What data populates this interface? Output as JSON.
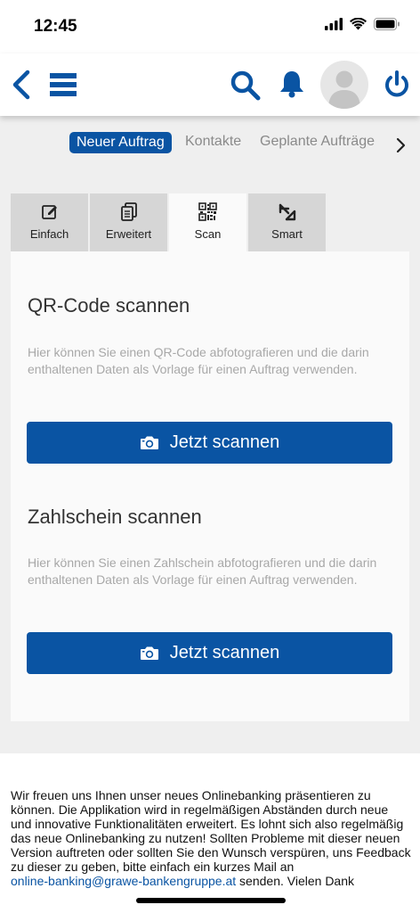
{
  "status_bar": {
    "time": "12:45"
  },
  "header": {
    "icons": [
      "back-icon",
      "menu-icon",
      "search-icon",
      "bell-icon",
      "avatar",
      "power-icon"
    ],
    "accent_color": "#0a54a3"
  },
  "subnav": {
    "items": [
      "Neuer Auftrag",
      "Kontakte",
      "Geplante Aufträge"
    ],
    "active": "Neuer Auftrag"
  },
  "tabs": [
    {
      "label": "Einfach",
      "icon": "edit-icon"
    },
    {
      "label": "Erweitert",
      "icon": "copy-icon"
    },
    {
      "label": "Scan",
      "icon": "qr-code-icon",
      "active": true
    },
    {
      "label": "Smart",
      "icon": "smart-icon"
    }
  ],
  "qr_section": {
    "title": "QR-Code scannen",
    "description": "Hier können Sie einen QR-Code abfotografieren und die darin enthaltenen Daten als Vorlage für einen Auftrag verwenden.",
    "button_label": "Jetzt scannen"
  },
  "zahlschein_section": {
    "title": "Zahlschein scannen",
    "description": "Hier können Sie einen Zahlschein abfotografieren und die darin enthaltenen Daten als Vorlage für einen Auftrag verwenden.",
    "button_label": "Jetzt scannen"
  },
  "info": {
    "text": "Wir freuen uns Ihnen unser neues Onlinebanking präsentieren zu können. Die Applikation wird in regelmäßigen Abständen durch neue und innovative Funktionalitäten erweitert. Es lohnt sich also regelmäßig das neue Onlinebanking zu nutzen! Sollten Probleme mit dieser neuen Version auftreten oder sollten Sie den Wunsch verspüren, uns Feedback zu dieser zu geben, bitte einfach ein kurzes Mail an",
    "email": "online-banking@grawe-bankengruppe.at",
    "suffix": " senden. Vielen Dank"
  }
}
